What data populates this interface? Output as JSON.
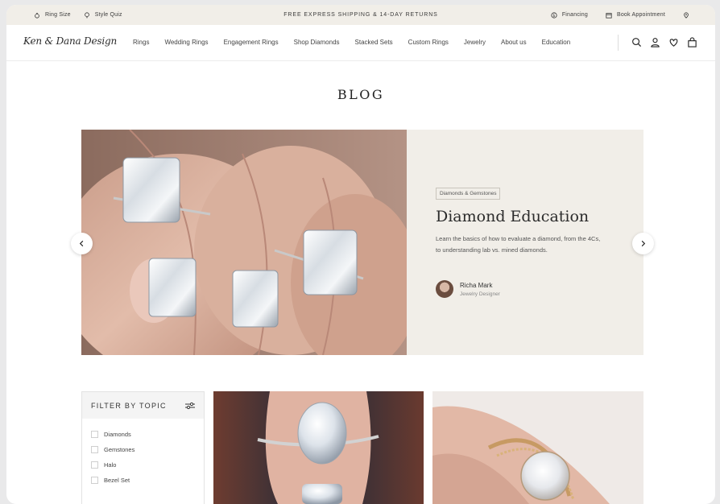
{
  "topbar": {
    "ring_size": "Ring Size",
    "style_quiz": "Style Quiz",
    "promo": "FREE EXPRESS SHIPPING & 14-DAY RETURNS",
    "financing": "Financing",
    "book_appointment": "Book Appointment"
  },
  "header": {
    "logo": "Ken & Dana Design",
    "nav": [
      "Rings",
      "Wedding Rings",
      "Engagement Rings",
      "Shop Diamonds",
      "Stacked Sets",
      "Custom Rings",
      "Jewelry",
      "About us",
      "Education"
    ],
    "icons": [
      "search-icon",
      "account-icon",
      "heart-icon",
      "bag-icon"
    ]
  },
  "page": {
    "title": "BLOG"
  },
  "hero": {
    "tag": "Diamonds & Gemstones",
    "heading": "Diamond Education",
    "description_line1": "Learn the basics of how to evaluate a diamond, from the 4Cs,",
    "description_line2": "to understanding lab vs. mined diamonds.",
    "author_name": "Richa Mark",
    "author_role": "Jewelry Designer"
  },
  "filter": {
    "title": "FILTER BY TOPIC",
    "options": [
      "Diamonds",
      "Gemstones",
      "Halo",
      "Bezel Set"
    ]
  },
  "colors": {
    "cream": "#f1eee8",
    "text": "#2b2b2b"
  }
}
